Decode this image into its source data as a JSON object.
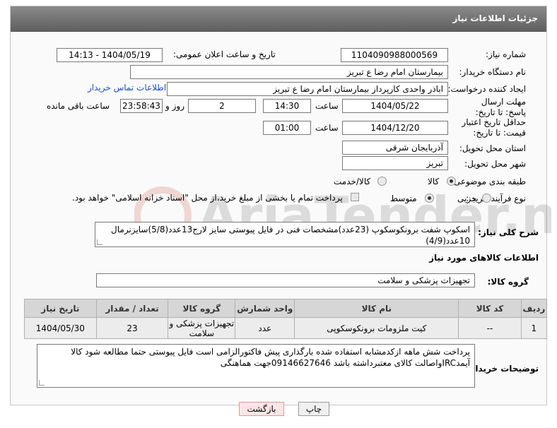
{
  "panel_title": "جزئیات اطلاعات نیاز",
  "labels": {
    "need_number": "شماره نیاز:",
    "announce_datetime": "تاریخ و ساعت اعلان عمومی:",
    "buyer_org": "نام دستگاه خریدار:",
    "requester": "ایجاد کننده درخواست:",
    "reply_deadline": "مهلت ارسال پاسخ: تا تاریخ:",
    "price_validity": "حداقل تاریخ اعتبار قیمت: تا تاریخ:",
    "time": "ساعت",
    "day_and": "روز و",
    "hours_left": "ساعت باقی مانده",
    "province": "استان محل تحویل:",
    "city": "شهر محل تحویل:",
    "category": "طبقه بندی موضوعی:",
    "process_type": "نوع فرآیند خرید :",
    "general_desc": "شرح کلی نیاز:",
    "goods_info": "اطلاعات کالاهای مورد نیاز",
    "goods_group": "گروه کالا:",
    "buyer_notes": "توضیحات خریدار:"
  },
  "values": {
    "need_number": "1104090988000569",
    "announce_datetime": "1404/05/19 - 14:13",
    "buyer_org": "بیمارستان امام رضا  ع  تبریز",
    "requester": "اباذر واحدی کارپرداز بیمارستان امام رضا  ع  تبریز",
    "contact_link": "اطلاعات تماس خریدار",
    "reply_date": "1404/05/22",
    "reply_time": "14:30",
    "days": "2",
    "remaining": "23:58:43",
    "price_date": "1404/12/20",
    "price_time": "01:00",
    "province": "آذربایجان شرقی",
    "city": "تبریز",
    "general_desc": "اسکوپ شفت برونکوسکوپ (23عدد)مشخصات فنی در فایل پیوستی  سایز لارج13عدد(5/8)سایزنرمال 10عدد(4/9)",
    "goods_group": "تجهیزات پزشکی و سلامت",
    "buyer_notes": "پرداخت شش  ماهه ازکدمشابه استفاده شده بارگذاری پیش فاکتورالزامی است فایل پیوستی حتما مطالعه شود کالا آیمدIRCواصالت کالای معتبرداشته باشد  09146627646جهت هماهنگی"
  },
  "category_options": [
    {
      "label": "کالا",
      "selected": true
    },
    {
      "label": "کالا/خدمت",
      "selected": false
    }
  ],
  "process_options": [
    {
      "label": "جزیی",
      "selected": false
    },
    {
      "label": "متوسط",
      "selected": true
    }
  ],
  "payment_note": "پرداخت تمام یا بخشی از مبلغ خرید،از محل \"اسناد خزانه اسلامی\" خواهد بود.",
  "table": {
    "headers": [
      "ردیف",
      "کد کالا",
      "نام کالا",
      "واحد شمارش",
      "گروه کالا",
      "تعداد / مقدار",
      "تاریخ نیاز"
    ],
    "rows": [
      [
        "1",
        "--",
        "کیت ملزومات برونکوسکوپی",
        "عدد",
        "تجهیزات پزشکی و سلامت",
        "23",
        "1404/05/30"
      ]
    ]
  },
  "buttons": {
    "print": "چاپ",
    "back": "بازگشت"
  },
  "watermark": "AriaTender.neT"
}
